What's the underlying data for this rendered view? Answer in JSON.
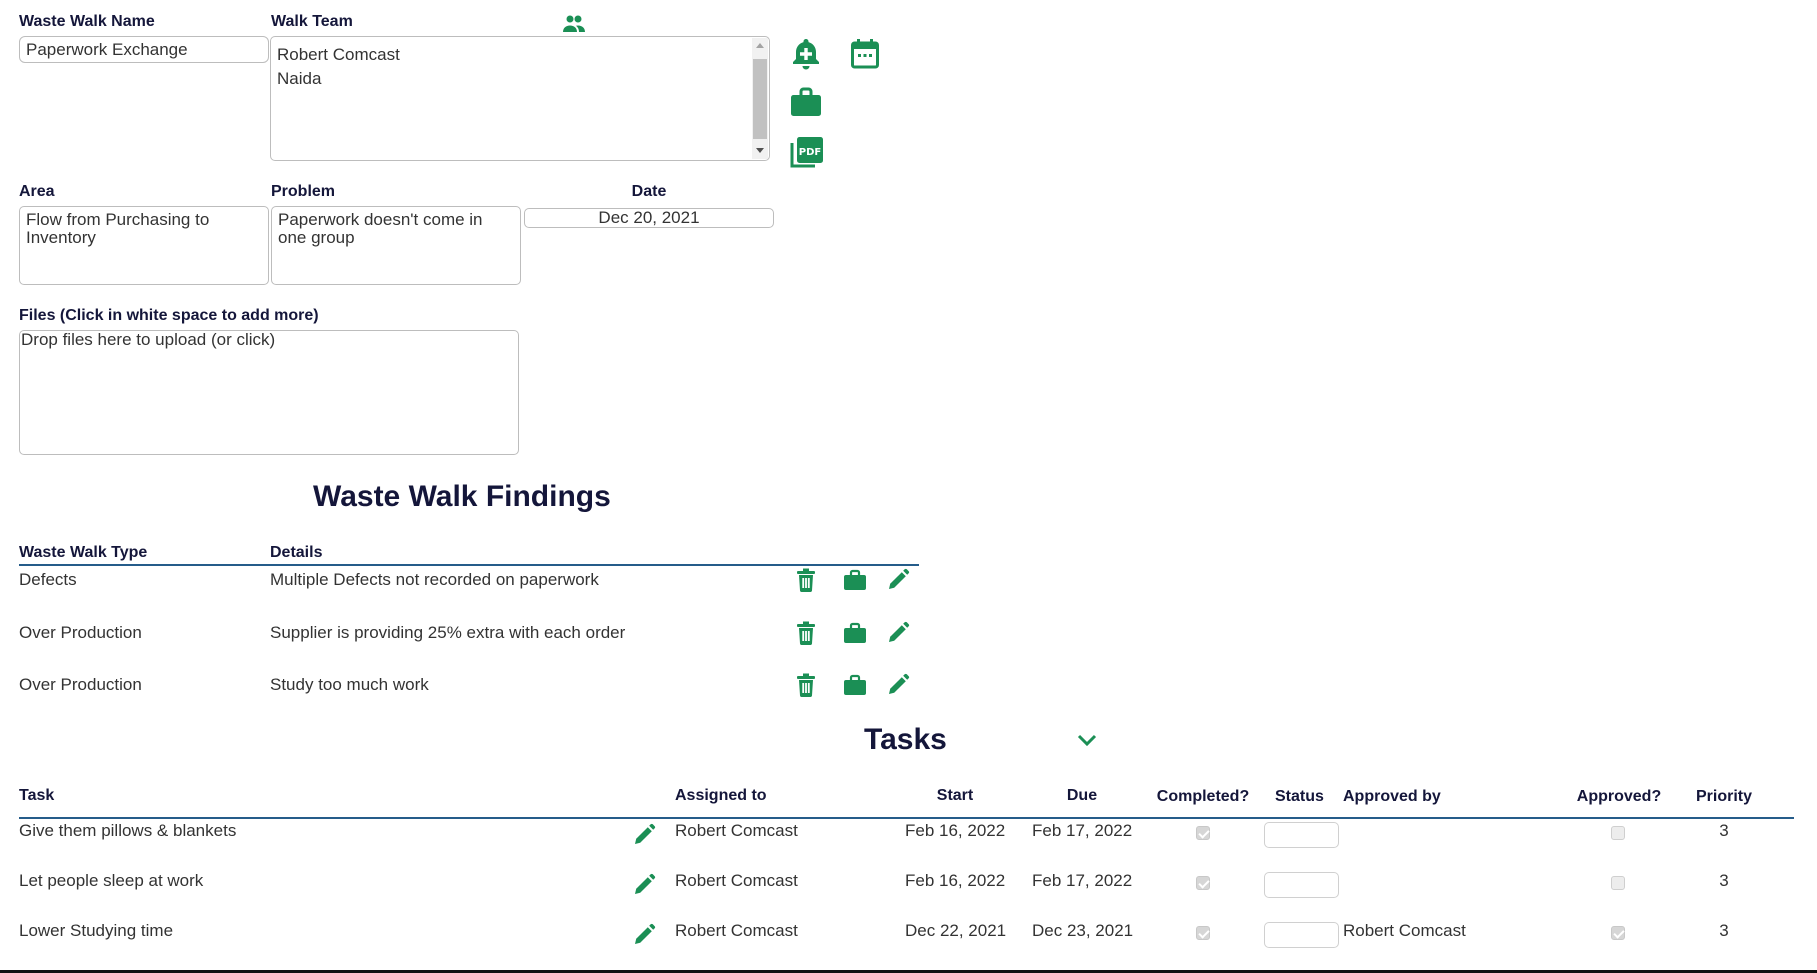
{
  "walk": {
    "name_label": "Waste Walk Name",
    "name_value": "Paperwork Exchange",
    "team_label": "Walk Team",
    "team_members": [
      "Robert Comcast",
      "Naida"
    ],
    "area_label": "Area",
    "area_value": "Flow from Purchasing to Inventory",
    "problem_label": "Problem",
    "problem_value": "Paperwork doesn't come in one group",
    "date_label": "Date",
    "date_value": "Dec 20, 2021",
    "files_label": "Files (Click in white space to add more)",
    "files_placeholder": "Drop files here to upload (or click)"
  },
  "icons": {
    "team": "people-icon",
    "add_reminder": "bell-plus-icon",
    "calendar": "calendar-icon",
    "briefcase": "briefcase-icon",
    "pdf": "pdf-icon",
    "delete": "trash-icon",
    "edit": "pencil-icon",
    "collapse": "chevron-down-icon"
  },
  "colors": {
    "accent": "#1b8f55",
    "heading": "#14163a",
    "rule": "#255c8a"
  },
  "findings": {
    "title": "Waste Walk Findings",
    "headers": {
      "type": "Waste Walk Type",
      "details": "Details"
    },
    "rows": [
      {
        "type": "Defects",
        "details": "Multiple Defects not recorded on paperwork"
      },
      {
        "type": "Over Production",
        "details": "Supplier is providing 25% extra with each order"
      },
      {
        "type": "Over Production",
        "details": "Study too much work"
      }
    ]
  },
  "tasks": {
    "title": "Tasks",
    "headers": {
      "task": "Task",
      "assigned": "Assigned to",
      "start": "Start",
      "due": "Due",
      "completed": "Completed?",
      "status": "Status",
      "approved_by": "Approved by",
      "approved": "Approved?",
      "priority": "Priority"
    },
    "rows": [
      {
        "task": "Give them pillows & blankets",
        "assigned": "Robert Comcast",
        "start": "Feb 16, 2022",
        "due": "Feb 17, 2022",
        "completed": true,
        "status": "",
        "approved_by": "",
        "approved": false,
        "priority": "3"
      },
      {
        "task": "Let people sleep at work",
        "assigned": "Robert Comcast",
        "start": "Feb 16, 2022",
        "due": "Feb 17, 2022",
        "completed": true,
        "status": "",
        "approved_by": "",
        "approved": false,
        "priority": "3"
      },
      {
        "task": "Lower Studying time",
        "assigned": "Robert Comcast",
        "start": "Dec 22, 2021",
        "due": "Dec 23, 2021",
        "completed": true,
        "status": "",
        "approved_by": "Robert Comcast",
        "approved": true,
        "priority": "3"
      }
    ]
  }
}
